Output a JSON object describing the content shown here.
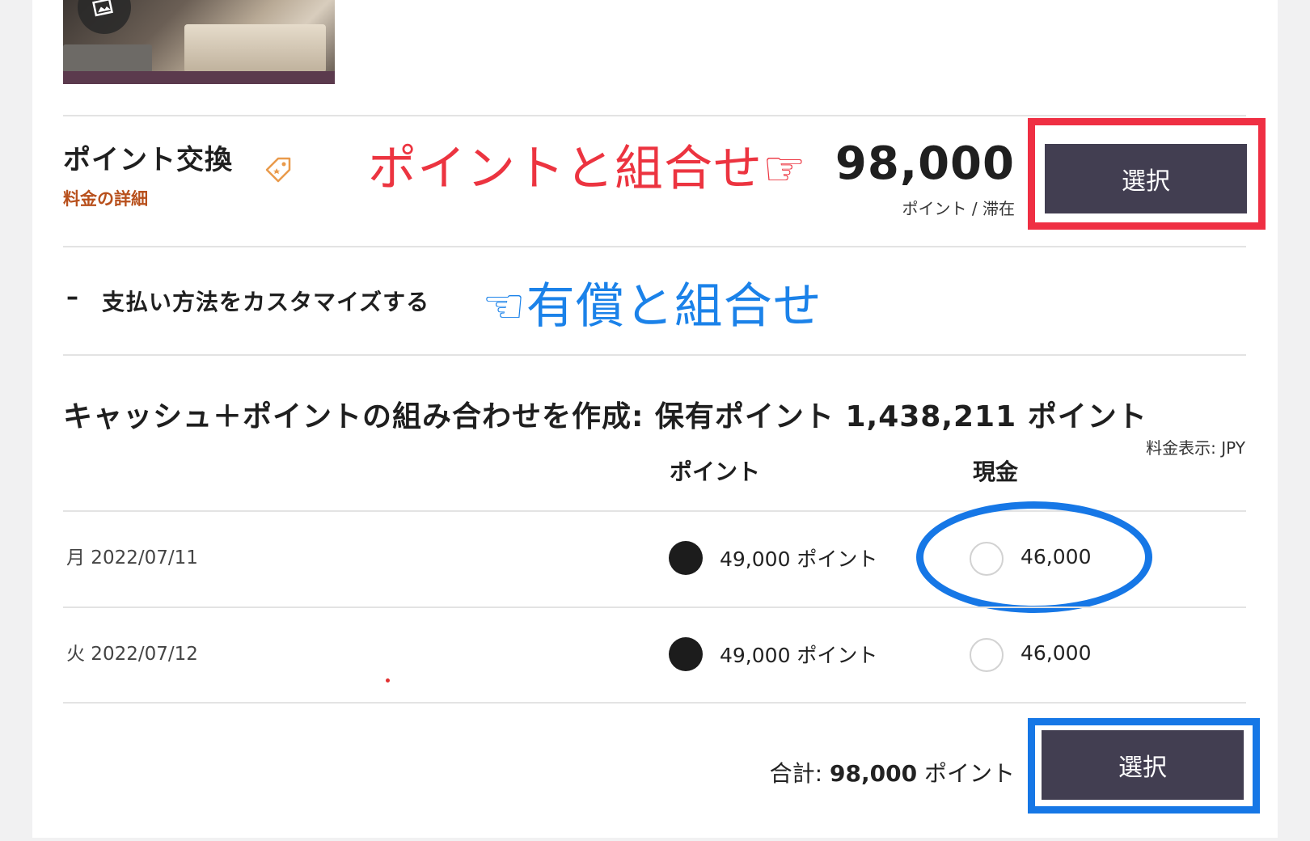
{
  "redemption": {
    "title": "ポイント交換",
    "rate_details_link": "料金の詳細",
    "points": "98,000",
    "unit": "ポイント / 滞在",
    "select_label": "選択"
  },
  "annotations": {
    "red": "ポイントと組合せ☞",
    "blue": "☜有償と組合せ"
  },
  "customize": {
    "toggle": "–",
    "label": "支払い方法をカスタマイズする"
  },
  "combination": {
    "title": "キャッシュ＋ポイントの組み合わせを作成: 保有ポイント 1,438,211 ポイント",
    "currency_note": "料金表示: JPY",
    "col_points": "ポイント",
    "col_cash": "現金",
    "rows": [
      {
        "date": "月 2022/07/11",
        "points_option": "49,000 ポイント",
        "cash_option": "46,000",
        "selected": "points"
      },
      {
        "date": "火 2022/07/12",
        "points_option": "49,000 ポイント",
        "cash_option": "46,000",
        "selected": "points"
      }
    ],
    "total_prefix": "合計:",
    "total_value": "98,000",
    "total_suffix": "ポイント",
    "select_label": "選択"
  },
  "colors": {
    "button_bg": "#423e51",
    "annotation_red": "#ef2f43",
    "annotation_blue": "#1677e6",
    "link_orange": "#b8501c"
  },
  "icons": [
    "gallery-icon",
    "tag-icon"
  ]
}
